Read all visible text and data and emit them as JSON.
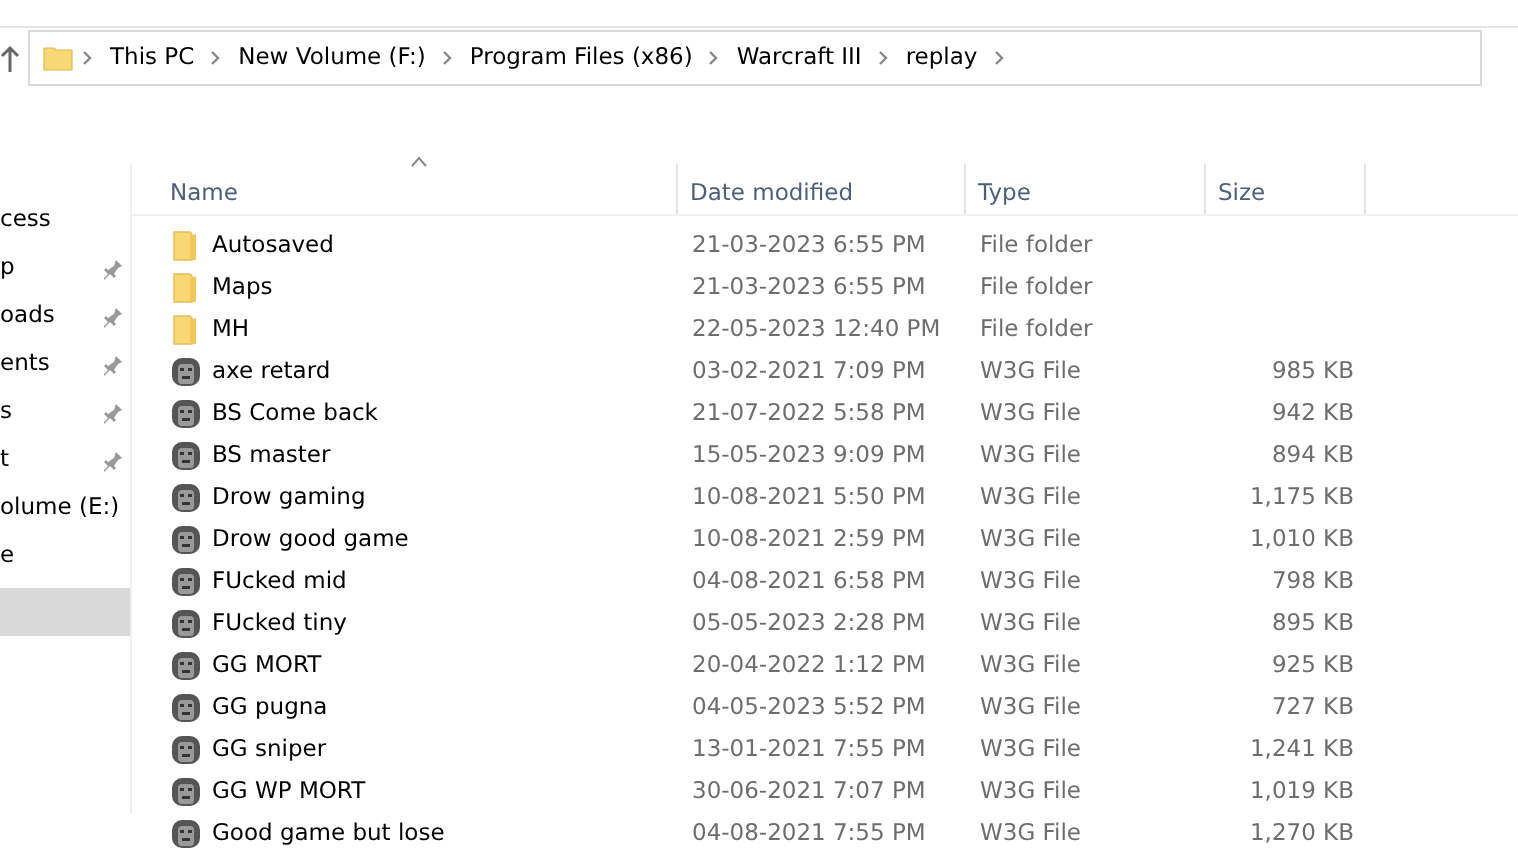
{
  "address_bar": {
    "path": [
      "This PC",
      "New Volume (F:)",
      "Program Files (x86)",
      "Warcraft III",
      "replay"
    ]
  },
  "sidebar": {
    "items": [
      {
        "label": "cess",
        "pinned": false,
        "selected": false
      },
      {
        "label": "p",
        "pinned": true,
        "selected": false
      },
      {
        "label": "oads",
        "pinned": true,
        "selected": false
      },
      {
        "label": "ents",
        "pinned": true,
        "selected": false
      },
      {
        "label": "s",
        "pinned": true,
        "selected": false
      },
      {
        "label": "t",
        "pinned": true,
        "selected": false
      },
      {
        "label": "olume (E:)",
        "pinned": false,
        "selected": false
      },
      {
        "label": "e",
        "pinned": false,
        "selected": false
      },
      {
        "pinned": false,
        "selected": true
      }
    ]
  },
  "table": {
    "columns": [
      "Name",
      "Date modified",
      "Type",
      "Size"
    ],
    "rows": [
      {
        "kind": "folder",
        "name": "Autosaved",
        "date": "21-03-2023 6:55 PM",
        "type": "File folder",
        "size": ""
      },
      {
        "kind": "folder",
        "name": "Maps",
        "date": "21-03-2023 6:55 PM",
        "type": "File folder",
        "size": ""
      },
      {
        "kind": "folder",
        "name": "MH",
        "date": "22-05-2023 12:40 PM",
        "type": "File folder",
        "size": ""
      },
      {
        "kind": "replay",
        "name": "axe retard",
        "date": "03-02-2021 7:09 PM",
        "type": "W3G File",
        "size": "985 KB"
      },
      {
        "kind": "replay",
        "name": "BS Come back",
        "date": "21-07-2022 5:58 PM",
        "type": "W3G File",
        "size": "942 KB"
      },
      {
        "kind": "replay",
        "name": "BS master",
        "date": "15-05-2023 9:09 PM",
        "type": "W3G File",
        "size": "894 KB"
      },
      {
        "kind": "replay",
        "name": "Drow gaming",
        "date": "10-08-2021 5:50 PM",
        "type": "W3G File",
        "size": "1,175 KB"
      },
      {
        "kind": "replay",
        "name": "Drow good game",
        "date": "10-08-2021 2:59 PM",
        "type": "W3G File",
        "size": "1,010 KB"
      },
      {
        "kind": "replay",
        "name": "FUcked mid",
        "date": "04-08-2021 6:58 PM",
        "type": "W3G File",
        "size": "798 KB"
      },
      {
        "kind": "replay",
        "name": "FUcked tiny",
        "date": "05-05-2023 2:28 PM",
        "type": "W3G File",
        "size": "895 KB"
      },
      {
        "kind": "replay",
        "name": "GG MORT",
        "date": "20-04-2022 1:12 PM",
        "type": "W3G File",
        "size": "925 KB"
      },
      {
        "kind": "replay",
        "name": "GG pugna",
        "date": "04-05-2023 5:52 PM",
        "type": "W3G File",
        "size": "727 KB"
      },
      {
        "kind": "replay",
        "name": "GG sniper",
        "date": "13-01-2021 7:55 PM",
        "type": "W3G File",
        "size": "1,241 KB"
      },
      {
        "kind": "replay",
        "name": "GG WP MORT",
        "date": "30-06-2021 7:07 PM",
        "type": "W3G File",
        "size": "1,019 KB"
      },
      {
        "kind": "replay",
        "name": "Good game but lose",
        "date": "04-08-2021 7:55 PM",
        "type": "W3G File",
        "size": "1,270 KB"
      }
    ]
  }
}
